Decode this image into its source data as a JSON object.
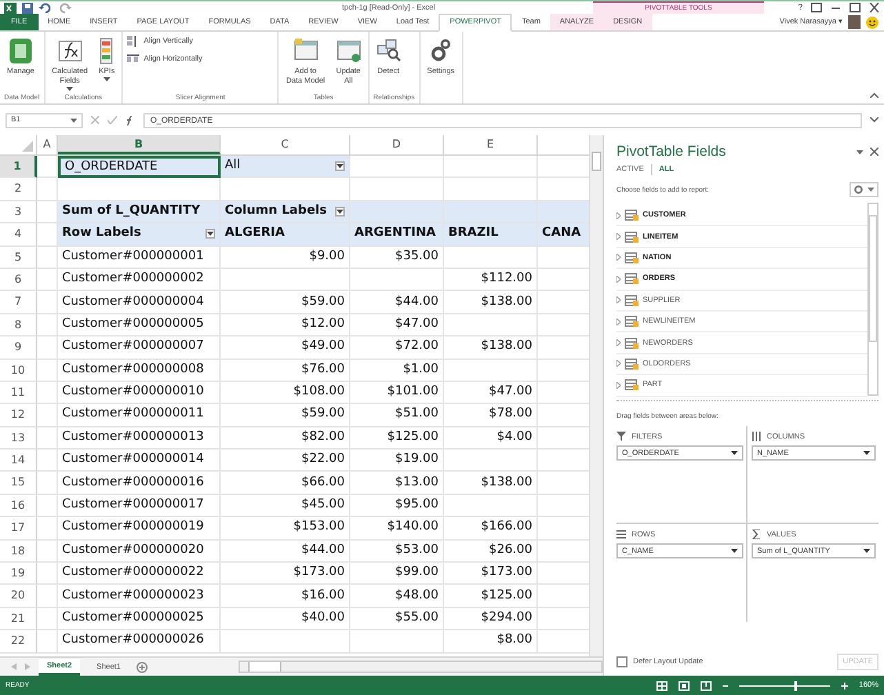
{
  "title_bar": {
    "title": "tpch-1g [Read-Only] - Excel",
    "tool_context": "PIVOTTABLE TOOLS",
    "user": "Vivek Narasayya ▾",
    "help": "?"
  },
  "ribbon_tabs": [
    {
      "label": "FILE",
      "kind": "file",
      "selected": false
    },
    {
      "label": "HOME",
      "kind": "normal",
      "selected": false
    },
    {
      "label": "INSERT",
      "kind": "normal",
      "selected": false
    },
    {
      "label": "PAGE LAYOUT",
      "kind": "normal",
      "selected": false
    },
    {
      "label": "FORMULAS",
      "kind": "normal",
      "selected": false
    },
    {
      "label": "DATA",
      "kind": "normal",
      "selected": false
    },
    {
      "label": "REVIEW",
      "kind": "normal",
      "selected": false
    },
    {
      "label": "VIEW",
      "kind": "normal",
      "selected": false
    },
    {
      "label": "Load Test",
      "kind": "normal",
      "selected": false
    },
    {
      "label": "POWERPIVOT",
      "kind": "normal",
      "selected": true
    },
    {
      "label": "Team",
      "kind": "normal",
      "selected": false
    },
    {
      "label": "ANALYZE",
      "kind": "context",
      "selected": false
    },
    {
      "label": "DESIGN",
      "kind": "context",
      "selected": false
    }
  ],
  "ribbon_groups": [
    {
      "label": "Data Model",
      "buttons": [
        {
          "kind": "large",
          "lines": [
            "Manage"
          ],
          "dropdown": false
        }
      ]
    },
    {
      "label": "Calculations",
      "buttons": [
        {
          "kind": "large",
          "lines": [
            "Calculated",
            "Fields"
          ],
          "dropdown": true
        },
        {
          "kind": "large",
          "lines": [
            "KPIs"
          ],
          "dropdown": true
        }
      ]
    },
    {
      "label": "Slicer Alignment",
      "buttons": [
        {
          "kind": "small",
          "lines": [
            "Align Vertically"
          ],
          "dropdown": false
        },
        {
          "kind": "small",
          "lines": [
            "Align Horizontally"
          ],
          "dropdown": false
        }
      ]
    },
    {
      "label": "Tables",
      "buttons": [
        {
          "kind": "large",
          "lines": [
            "Add to",
            "Data Model"
          ],
          "dropdown": false
        },
        {
          "kind": "large",
          "lines": [
            "Update",
            "All"
          ],
          "dropdown": false
        }
      ]
    },
    {
      "label": "Relationships",
      "buttons": [
        {
          "kind": "large",
          "lines": [
            "Detect"
          ],
          "dropdown": false
        }
      ]
    },
    {
      "buttons": [
        {
          "kind": "large",
          "lines": [
            "Settings"
          ],
          "dropdown": false
        }
      ]
    }
  ],
  "formula_bar": {
    "name_box": "B1",
    "formula": "O_ORDERDATE"
  },
  "columns": [
    {
      "label": "A",
      "selected": false
    },
    {
      "label": "B",
      "selected": true
    },
    {
      "label": "C",
      "selected": false
    },
    {
      "label": "D",
      "selected": false
    },
    {
      "label": "E",
      "selected": false
    }
  ],
  "rows": [
    {
      "number": "1",
      "kind": "filter",
      "selected": true,
      "cells": [
        null,
        {
          "text": "O_ORDERDATE",
          "selected": true
        },
        {
          "text": "All",
          "dropdown": true
        },
        null,
        null,
        null
      ]
    },
    {
      "number": "2",
      "kind": "blank",
      "selected": false,
      "cells": [
        null,
        null,
        null,
        null,
        null,
        null
      ]
    },
    {
      "number": "3",
      "kind": "header",
      "selected": false,
      "cells": [
        null,
        "Sum of L_QUANTITY",
        {
          "text": "Column Labels",
          "dropdown": true
        },
        null,
        null,
        null
      ]
    },
    {
      "number": "4",
      "kind": "header",
      "selected": false,
      "cells": [
        null,
        {
          "text": "Row Labels",
          "dropdown": true
        },
        "ALGERIA",
        "ARGENTINA",
        "BRAZIL",
        "CANA"
      ]
    },
    {
      "number": "5",
      "kind": "data",
      "selected": false,
      "cells": [
        null,
        "Customer#000000001",
        "$9.00",
        "$35.00",
        null,
        null
      ]
    },
    {
      "number": "6",
      "kind": "data",
      "selected": false,
      "cells": [
        null,
        "Customer#000000002",
        null,
        null,
        "$112.00",
        null
      ]
    },
    {
      "number": "7",
      "kind": "data",
      "selected": false,
      "cells": [
        null,
        "Customer#000000004",
        "$59.00",
        "$44.00",
        "$138.00",
        null
      ]
    },
    {
      "number": "8",
      "kind": "data",
      "selected": false,
      "cells": [
        null,
        "Customer#000000005",
        "$12.00",
        "$47.00",
        null,
        null
      ]
    },
    {
      "number": "9",
      "kind": "data",
      "selected": false,
      "cells": [
        null,
        "Customer#000000007",
        "$49.00",
        "$72.00",
        "$138.00",
        null
      ]
    },
    {
      "number": "10",
      "kind": "data",
      "selected": false,
      "cells": [
        null,
        "Customer#000000008",
        "$76.00",
        "$1.00",
        null,
        null
      ]
    },
    {
      "number": "11",
      "kind": "data",
      "selected": false,
      "cells": [
        null,
        "Customer#000000010",
        "$108.00",
        "$101.00",
        "$47.00",
        null
      ]
    },
    {
      "number": "12",
      "kind": "data",
      "selected": false,
      "cells": [
        null,
        "Customer#000000011",
        "$59.00",
        "$51.00",
        "$78.00",
        null
      ]
    },
    {
      "number": "13",
      "kind": "data",
      "selected": false,
      "cells": [
        null,
        "Customer#000000013",
        "$82.00",
        "$125.00",
        "$4.00",
        null
      ]
    },
    {
      "number": "14",
      "kind": "data",
      "selected": false,
      "cells": [
        null,
        "Customer#000000014",
        "$22.00",
        "$19.00",
        null,
        null
      ]
    },
    {
      "number": "15",
      "kind": "data",
      "selected": false,
      "cells": [
        null,
        "Customer#000000016",
        "$66.00",
        "$13.00",
        "$138.00",
        null
      ]
    },
    {
      "number": "16",
      "kind": "data",
      "selected": false,
      "cells": [
        null,
        "Customer#000000017",
        "$45.00",
        "$95.00",
        null,
        null
      ]
    },
    {
      "number": "17",
      "kind": "data",
      "selected": false,
      "cells": [
        null,
        "Customer#000000019",
        "$153.00",
        "$140.00",
        "$166.00",
        null
      ]
    },
    {
      "number": "18",
      "kind": "data",
      "selected": false,
      "cells": [
        null,
        "Customer#000000020",
        "$44.00",
        "$53.00",
        "$26.00",
        null
      ]
    },
    {
      "number": "19",
      "kind": "data",
      "selected": false,
      "cells": [
        null,
        "Customer#000000022",
        "$173.00",
        "$99.00",
        "$173.00",
        null
      ]
    },
    {
      "number": "20",
      "kind": "data",
      "selected": false,
      "cells": [
        null,
        "Customer#000000023",
        "$16.00",
        "$48.00",
        "$125.00",
        null
      ]
    },
    {
      "number": "21",
      "kind": "data",
      "selected": false,
      "cells": [
        null,
        "Customer#000000025",
        "$40.00",
        "$55.00",
        "$294.00",
        null
      ]
    },
    {
      "number": "22",
      "kind": "data",
      "selected": false,
      "cells": [
        null,
        "Customer#000000026",
        null,
        null,
        "$8.00",
        null
      ]
    }
  ],
  "sheet_tabs": [
    {
      "label": "Sheet2",
      "selected": true
    },
    {
      "label": "Sheet1",
      "selected": false
    }
  ],
  "pivot_pane": {
    "title": "PivotTable Fields",
    "tabs": [
      {
        "label": "ACTIVE",
        "selected": false
      },
      {
        "label": "ALL",
        "selected": true
      }
    ],
    "prompt": "Choose fields to add to report:",
    "fields": [
      {
        "name": "CUSTOMER",
        "active": true
      },
      {
        "name": "LINEITEM",
        "active": true
      },
      {
        "name": "NATION",
        "active": true
      },
      {
        "name": "ORDERS",
        "active": true
      },
      {
        "name": "SUPPLIER",
        "active": false
      },
      {
        "name": "NEWLINEITEM",
        "active": false
      },
      {
        "name": "NEWORDERS",
        "active": false
      },
      {
        "name": "OLDORDERS",
        "active": false
      },
      {
        "name": "PART",
        "active": false
      }
    ],
    "areas_prompt": "Drag fields between areas below:",
    "areas": [
      {
        "kind": "filters",
        "label": "FILTERS",
        "field": "O_ORDERDATE"
      },
      {
        "kind": "columns",
        "label": "COLUMNS",
        "field": "N_NAME"
      },
      {
        "kind": "rows",
        "label": "ROWS",
        "field": "C_NAME"
      },
      {
        "kind": "values",
        "label": "VALUES",
        "field": "Sum of L_QUANTITY"
      }
    ],
    "defer": {
      "label": "Defer Layout Update",
      "checked": false
    },
    "update": {
      "label": "UPDATE",
      "disabled": true
    }
  },
  "status_bar": {
    "text": "READY",
    "zoom": "160%",
    "zoom_slider": {
      "level": 0.62
    }
  }
}
